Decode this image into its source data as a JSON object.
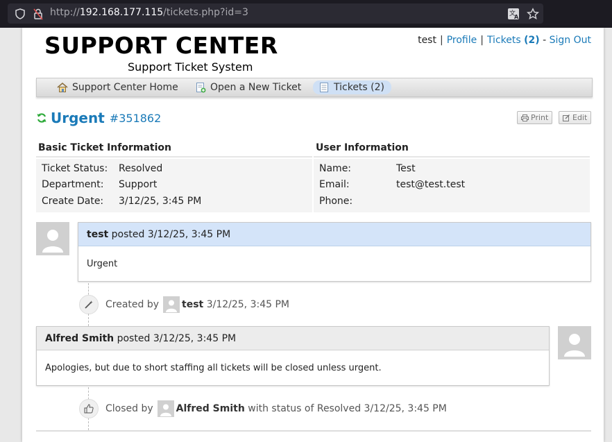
{
  "browser": {
    "url_prefix": "http://",
    "url_host": "192.168.177.115",
    "url_path": "/tickets.php?id=3"
  },
  "header": {
    "logo_title": "SUPPORT CENTER",
    "logo_subtitle": "Support Ticket System",
    "user": "test",
    "profile": "Profile",
    "tickets_label": "Tickets",
    "tickets_count": "(2)",
    "dash": "-",
    "sign_out": "Sign Out"
  },
  "nav": {
    "home": "Support Center Home",
    "new_ticket": "Open a New Ticket",
    "tickets": "Tickets (2)"
  },
  "ticket": {
    "title": "Urgent",
    "number": "#351862",
    "print_label": "Print",
    "edit_label": "Edit"
  },
  "basic_info": {
    "heading": "Basic Ticket Information",
    "rows": [
      {
        "label": "Ticket Status:",
        "value": "Resolved"
      },
      {
        "label": "Department:",
        "value": "Support"
      },
      {
        "label": "Create Date:",
        "value": "3/12/25, 3:45 PM"
      }
    ]
  },
  "user_info": {
    "heading": "User Information",
    "rows": [
      {
        "label": "Name:",
        "value": "Test"
      },
      {
        "label": "Email:",
        "value": "test@test.test"
      },
      {
        "label": "Phone:",
        "value": ""
      }
    ]
  },
  "thread": {
    "message1": {
      "author": "test",
      "posted": "posted",
      "date": "3/12/25, 3:45 PM",
      "body": "Urgent"
    },
    "event1": {
      "prefix": "Created by",
      "user": "test",
      "date": "3/12/25, 3:45 PM"
    },
    "message2": {
      "author": "Alfred Smith",
      "posted": "posted",
      "date": "3/12/25, 3:45 PM",
      "body": "Apologies, but due to short staffing all tickets will be closed unless urgent."
    },
    "event2": {
      "prefix": "Closed by",
      "user": "Alfred Smith",
      "middle": "with status of",
      "status": "Resolved",
      "date": "3/12/25, 3:45 PM"
    }
  },
  "colors": {
    "link": "#1a7ab8",
    "staff_header": "#ececec",
    "user_header": "#d4e4f9",
    "refresh": "#2eaa3a"
  }
}
